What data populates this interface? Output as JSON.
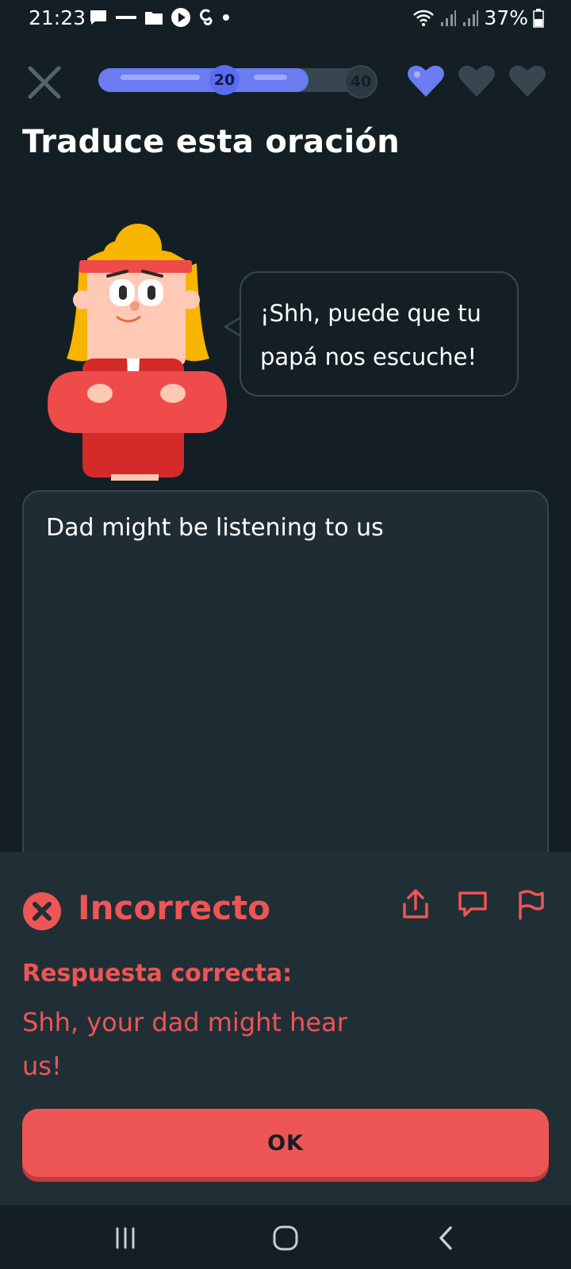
{
  "status_bar": {
    "time": "21:23",
    "battery": "37%",
    "icons": [
      "chat-icon",
      "coursera-icon",
      "folder-icon",
      "play-icon",
      "app-icon",
      "dot-icon",
      "wifi-icon",
      "signal-icon",
      "signal-icon",
      "battery-icon"
    ]
  },
  "header": {
    "progress_fraction": 0.77,
    "milestone_done": "20",
    "milestone_next": "40",
    "hearts_full": 1,
    "hearts_total": 3
  },
  "exercise": {
    "title": "Traduce esta oración",
    "prompt": "¡Shh, puede que tu papá nos escuche!",
    "user_answer": "Dad might be listening to us"
  },
  "feedback": {
    "title": "Incorrecto",
    "label": "Respuesta correcta:",
    "correct_answer": "Shh, your dad might hear us!",
    "ok_button": "OK"
  },
  "colors": {
    "background": "#131f24",
    "accent_blue": "#6a7cf0",
    "error_red": "#ee5555"
  }
}
